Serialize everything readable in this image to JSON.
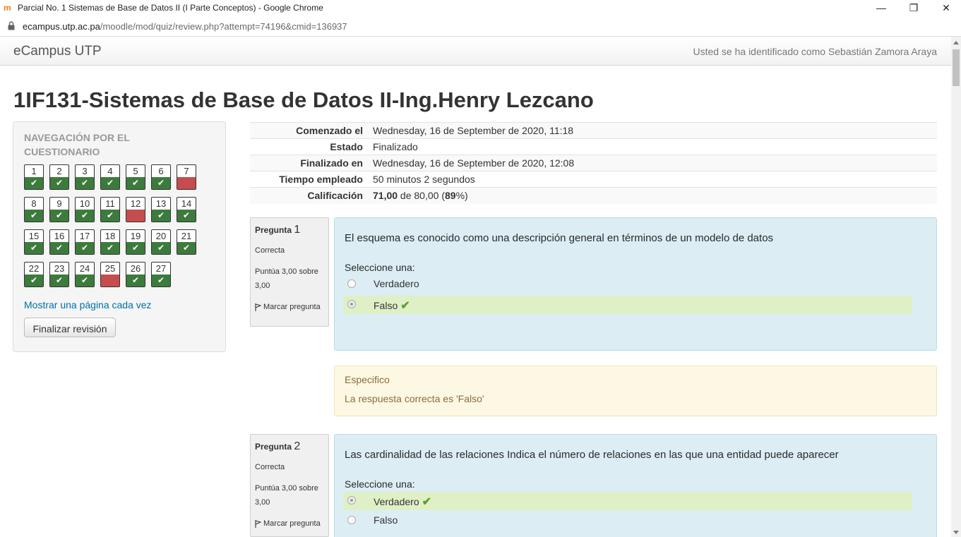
{
  "window": {
    "title": "Parcial No. 1 Sistemas de Base de Datos II (I Parte Conceptos) - Google Chrome",
    "minimize": "—",
    "restore": "❐",
    "close": "✕"
  },
  "address": {
    "host": "ecampus.utp.ac.pa",
    "path": "/moodle/mod/quiz/review.php?attempt=74196&cmid=136937"
  },
  "navbar": {
    "brand": "eCampus UTP",
    "user_text": "Usted se ha identificado como Sebastián Zamora Araya"
  },
  "page_title": "1IF131-Sistemas de Base de Datos II-Ing.Henry Lezcano",
  "quiz_nav": {
    "heading": "NAVEGACIÓN POR EL CUESTIONARIO",
    "questions": [
      {
        "num": "1",
        "state": "correct"
      },
      {
        "num": "2",
        "state": "correct"
      },
      {
        "num": "3",
        "state": "correct"
      },
      {
        "num": "4",
        "state": "correct"
      },
      {
        "num": "5",
        "state": "correct"
      },
      {
        "num": "6",
        "state": "correct"
      },
      {
        "num": "7",
        "state": "incorrect"
      },
      {
        "num": "8",
        "state": "correct"
      },
      {
        "num": "9",
        "state": "correct"
      },
      {
        "num": "10",
        "state": "correct"
      },
      {
        "num": "11",
        "state": "correct"
      },
      {
        "num": "12",
        "state": "incorrect"
      },
      {
        "num": "13",
        "state": "correct"
      },
      {
        "num": "14",
        "state": "correct"
      },
      {
        "num": "15",
        "state": "correct"
      },
      {
        "num": "16",
        "state": "correct"
      },
      {
        "num": "17",
        "state": "correct"
      },
      {
        "num": "18",
        "state": "correct"
      },
      {
        "num": "19",
        "state": "correct"
      },
      {
        "num": "20",
        "state": "correct"
      },
      {
        "num": "21",
        "state": "correct"
      },
      {
        "num": "22",
        "state": "correct"
      },
      {
        "num": "23",
        "state": "correct"
      },
      {
        "num": "24",
        "state": "correct"
      },
      {
        "num": "25",
        "state": "incorrect"
      },
      {
        "num": "26",
        "state": "correct"
      },
      {
        "num": "27",
        "state": "correct"
      }
    ],
    "show_one_link": "Mostrar una página cada vez",
    "finish_button": "Finalizar revisión"
  },
  "summary": {
    "rows": [
      {
        "label": "Comenzado el",
        "value": "Wednesday, 16 de September de 2020, 11:18"
      },
      {
        "label": "Estado",
        "value": "Finalizado"
      },
      {
        "label": "Finalizado en",
        "value": "Wednesday, 16 de September de 2020, 12:08"
      },
      {
        "label": "Tiempo empleado",
        "value": "50 minutos 2 segundos"
      }
    ],
    "grade_label": "Calificación",
    "grade_score": "71,00",
    "grade_of": " de 80,00 (",
    "grade_percent": "89",
    "grade_end": "%)"
  },
  "questions": [
    {
      "prefix": "Pregunta ",
      "number": "1",
      "status": "Correcta",
      "points": "Puntúa 3,00 sobre 3,00",
      "flag": "Marcar pregunta",
      "text": "El esquema  es conocido como  una descripción general en términos de un modelo de datos",
      "prompt": "Seleccione una:",
      "options": [
        "Verdadero",
        "Falso"
      ],
      "feedback_title": "Especifico",
      "feedback_answer": "La respuesta correcta es 'Falso'"
    },
    {
      "prefix": "Pregunta ",
      "number": "2",
      "status": "Correcta",
      "points": "Puntúa 3,00 sobre 3,00",
      "flag": "Marcar pregunta",
      "text": "Las cardinalidad de las relaciones Indica el número de relaciones en las que una entidad puede aparecer",
      "prompt": "Seleccione una:",
      "options": [
        "Verdadero",
        "Falso"
      ]
    }
  ],
  "tick_glyph": "✔",
  "colors": {
    "correct": "#3c7b3c",
    "incorrect": "#c54d4d",
    "link": "#0070a8",
    "question_bg": "#dcedf4"
  }
}
